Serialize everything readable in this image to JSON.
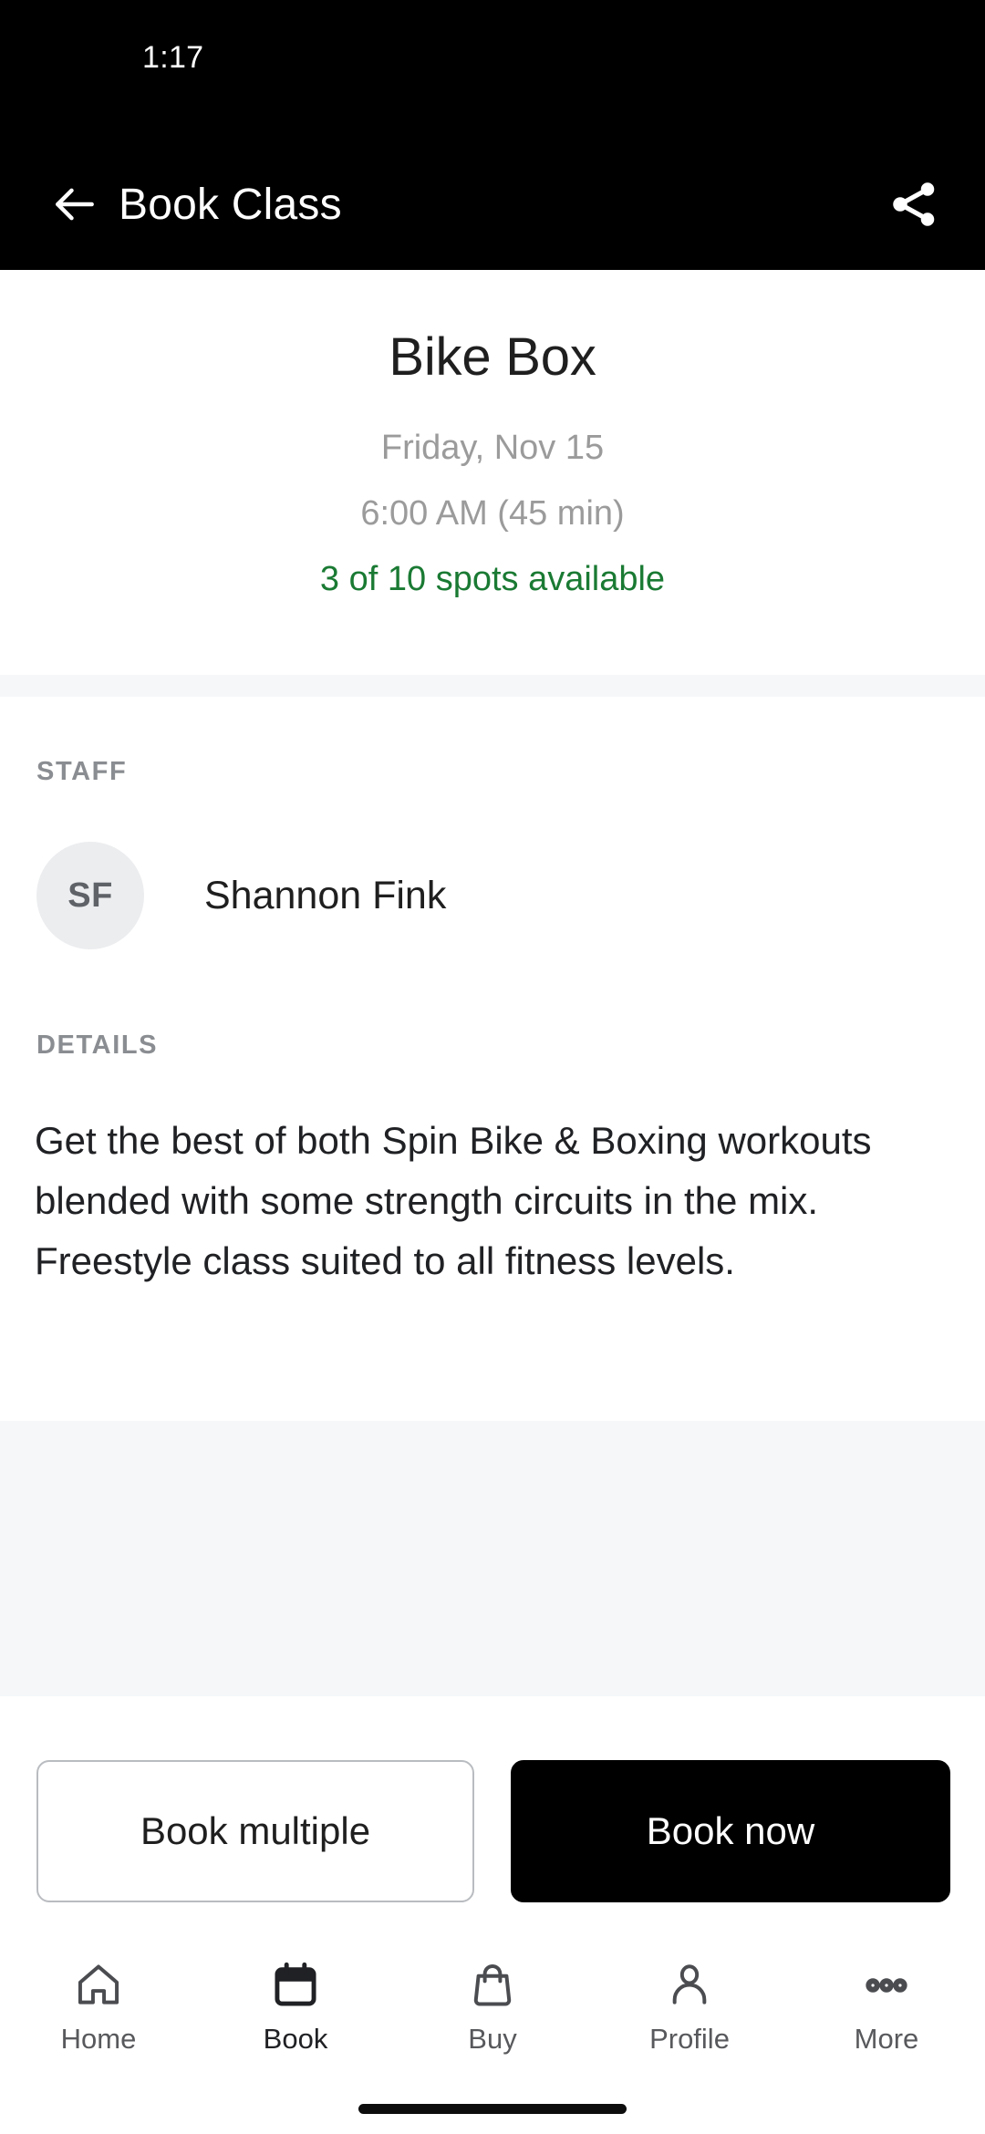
{
  "status_bar": {
    "time": "1:17"
  },
  "app_bar": {
    "title": "Book Class",
    "back_icon": "arrow-left-icon",
    "share_icon": "share-icon"
  },
  "class_summary": {
    "name": "Bike Box",
    "date": "Friday, Nov 15",
    "time_duration": "6:00 AM (45 min)",
    "availability": "3 of 10 spots available",
    "availability_color": "#1a7a33",
    "spots_open": 3,
    "spots_total": 10
  },
  "staff_section": {
    "label": "STAFF",
    "members": [
      {
        "initials": "SF",
        "name": "Shannon Fink"
      }
    ]
  },
  "details_section": {
    "label": "DETAILS",
    "text": "Get the best of both Spin Bike & Boxing workouts blended with some strength circuits in the mix. Freestyle class suited to all fitness levels."
  },
  "actions": {
    "secondary_label": "Book multiple",
    "primary_label": "Book now",
    "primary_bg": "#000000",
    "secondary_border": "#b9bcc0"
  },
  "bottom_nav": {
    "items": [
      {
        "label": "Home",
        "icon": "home-icon",
        "active": false
      },
      {
        "label": "Book",
        "icon": "calendar-icon",
        "active": true
      },
      {
        "label": "Buy",
        "icon": "shopping-bag-icon",
        "active": false
      },
      {
        "label": "Profile",
        "icon": "person-icon",
        "active": false
      },
      {
        "label": "More",
        "icon": "more-dots-icon",
        "active": false
      }
    ]
  }
}
